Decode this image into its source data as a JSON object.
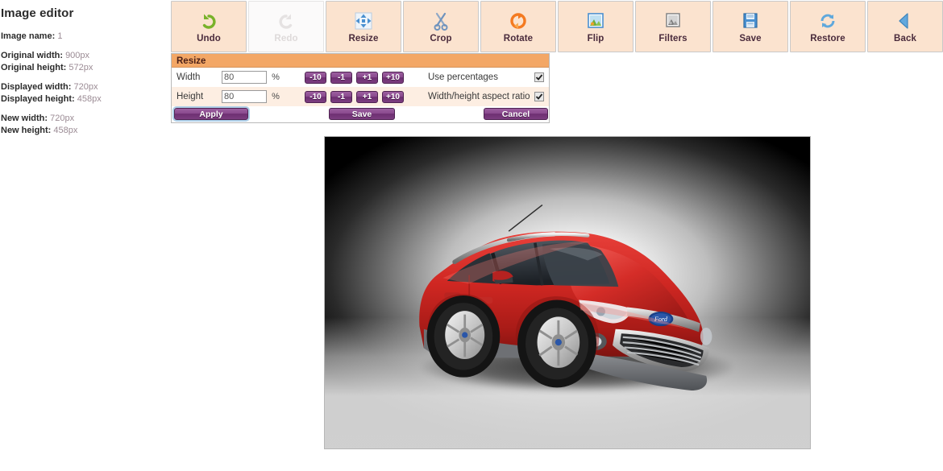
{
  "sidebar": {
    "title": "Image editor",
    "fields": [
      [
        {
          "label": "Image name:",
          "value": "1"
        }
      ],
      [
        {
          "label": "Original width:",
          "value": "900px"
        },
        {
          "label": "Original height:",
          "value": "572px"
        }
      ],
      [
        {
          "label": "Displayed width:",
          "value": "720px"
        },
        {
          "label": "Displayed height:",
          "value": "458px"
        }
      ],
      [
        {
          "label": "New width:",
          "value": "720px"
        },
        {
          "label": "New height:",
          "value": "458px"
        }
      ]
    ]
  },
  "toolbar": {
    "buttons": [
      {
        "label": "Undo",
        "icon": "undo-arrow-icon",
        "disabled": false
      },
      {
        "label": "Redo",
        "icon": "redo-arrow-icon",
        "disabled": true
      },
      {
        "label": "Resize",
        "icon": "resize-arrows-icon",
        "disabled": false
      },
      {
        "label": "Crop",
        "icon": "scissors-icon",
        "disabled": false
      },
      {
        "label": "Rotate",
        "icon": "rotate-circle-icon",
        "disabled": false
      },
      {
        "label": "Flip",
        "icon": "image-color-icon",
        "disabled": false
      },
      {
        "label": "Filters",
        "icon": "image-gray-icon",
        "disabled": false
      },
      {
        "label": "Save",
        "icon": "floppy-disk-icon",
        "disabled": false
      },
      {
        "label": "Restore",
        "icon": "refresh-cycle-icon",
        "disabled": false
      },
      {
        "label": "Back",
        "icon": "triangle-left-icon",
        "disabled": false
      }
    ]
  },
  "resize_panel": {
    "header": "Resize",
    "rows": [
      {
        "name": "Width",
        "value": "80",
        "unit": "%",
        "steppers": [
          "-10",
          "-1",
          "+1",
          "+10"
        ],
        "option_label": "Use percentages",
        "option_checked": true
      },
      {
        "name": "Height",
        "value": "80",
        "unit": "%",
        "steppers": [
          "-10",
          "-1",
          "+1",
          "+10"
        ],
        "option_label": "Width/height aspect ratio",
        "option_checked": true
      }
    ],
    "actions": {
      "apply": "Apply",
      "save": "Save",
      "cancel": "Cancel"
    }
  },
  "canvas": {
    "image_alt": "red-ford-ecosport-suv-studio-photo"
  },
  "colors": {
    "toolbar_button_bg": "#fbe3cf",
    "panel_header_bg": "#f3a766",
    "button_purple": "#7c3d80",
    "row_alt_bg": "#fdeee2",
    "label_text": "#2b2b2b",
    "value_text": "#9b8b94",
    "car_red": "#c0201f"
  }
}
